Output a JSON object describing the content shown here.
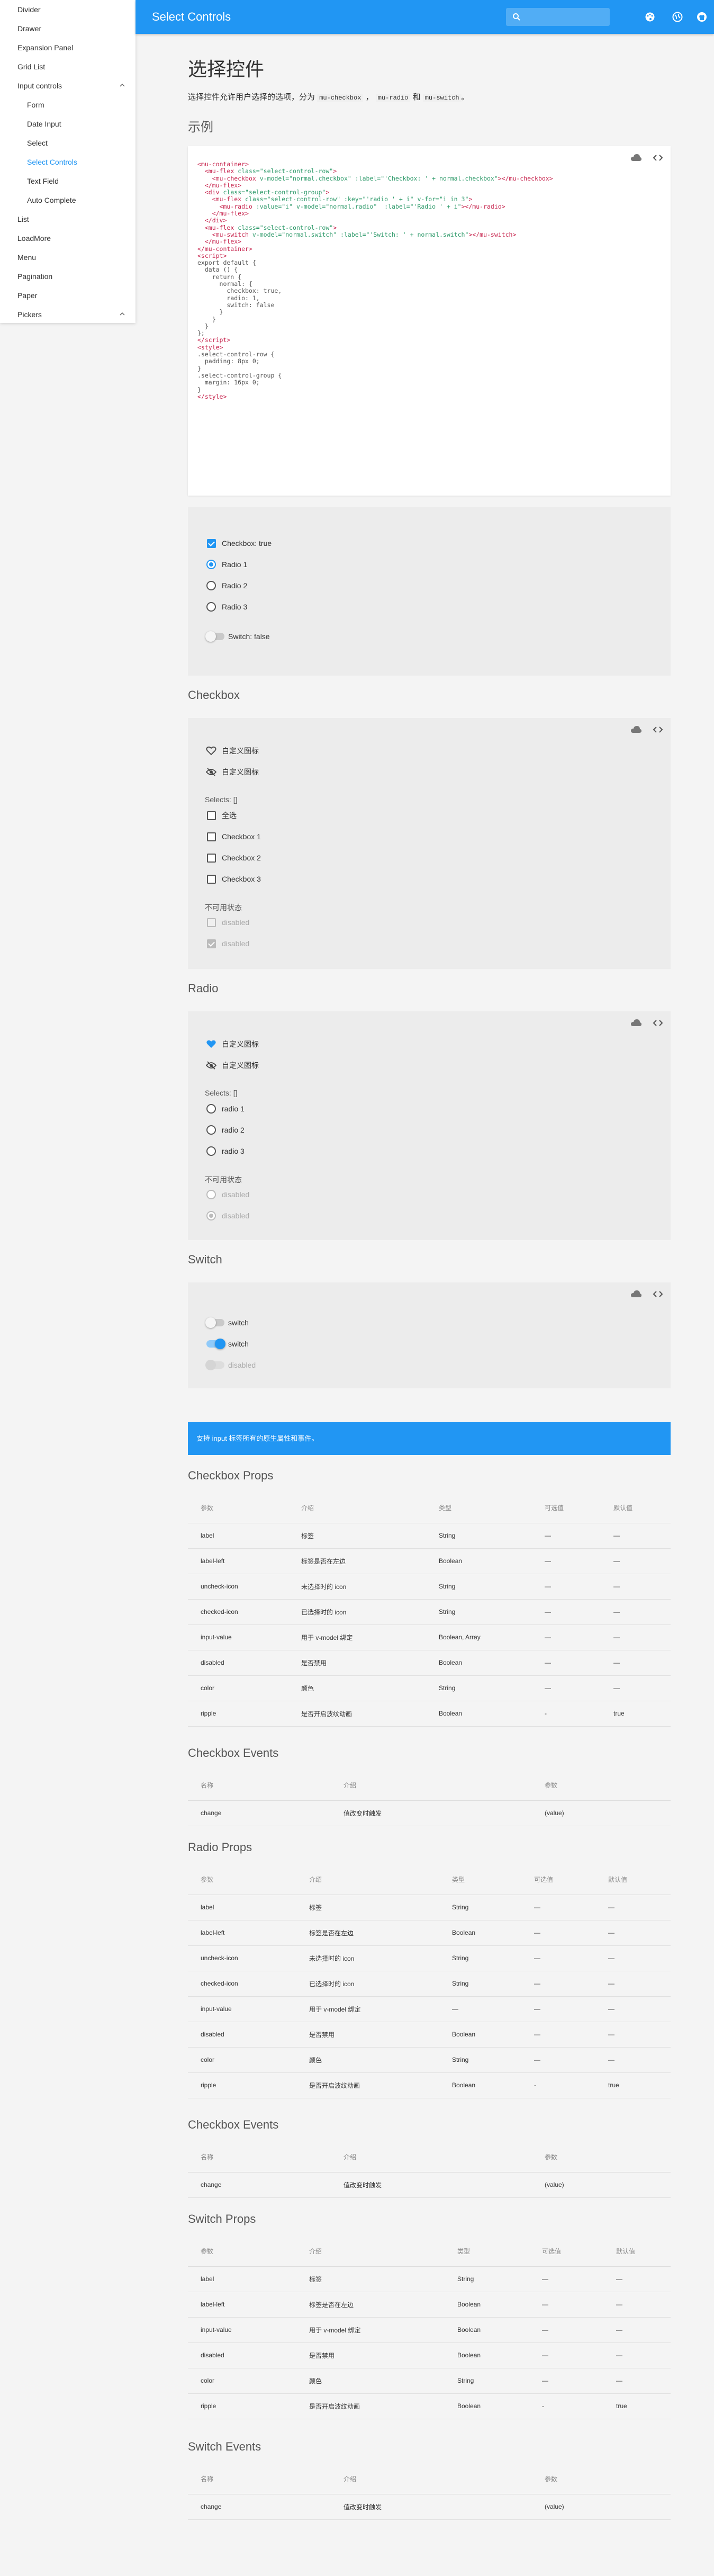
{
  "sidebar": {
    "items": [
      {
        "label": "Divider"
      },
      {
        "label": "Drawer"
      },
      {
        "label": "Expansion Panel"
      },
      {
        "label": "Grid List"
      },
      {
        "label": "Input controls"
      },
      {
        "label": "Form"
      },
      {
        "label": "Date Input"
      },
      {
        "label": "Select"
      },
      {
        "label": "Select Controls"
      },
      {
        "label": "Text Field"
      },
      {
        "label": "Auto Complete"
      },
      {
        "label": "List"
      },
      {
        "label": "LoadMore"
      },
      {
        "label": "Menu"
      },
      {
        "label": "Pagination"
      },
      {
        "label": "Paper"
      },
      {
        "label": "Pickers"
      }
    ]
  },
  "appbar": {
    "title": "Select Controls",
    "search_placeholder": ""
  },
  "page": {
    "title": "选择控件",
    "intro_prefix": "选择控件允许用户选择的选项，分为",
    "intro_code1": "mu-checkbox",
    "intro_sep1": "，",
    "intro_code2": "mu-radio",
    "intro_and": "和",
    "intro_code3": "mu-switch",
    "intro_end": "。",
    "example_heading": "示例"
  },
  "demo1": {
    "checkbox_label": "Checkbox: true",
    "radios": [
      "Radio 1",
      "Radio 2",
      "Radio 3"
    ],
    "switch_label": "Switch: false"
  },
  "checkbox_section": {
    "heading": "Checkbox",
    "custom1": "自定义图标",
    "custom2": "自定义图标",
    "selects": "Selects: []",
    "all": "全选",
    "items": [
      "Checkbox 1",
      "Checkbox 2",
      "Checkbox 3"
    ],
    "disabled_heading": "不可用状态",
    "disabled1": "disabled",
    "disabled2": "disabled"
  },
  "radio_section": {
    "heading": "Radio",
    "custom1": "自定义图标",
    "custom2": "自定义图标",
    "selects": "Selects: []",
    "items": [
      "radio 1",
      "radio 2",
      "radio 3"
    ],
    "disabled_heading": "不可用状态",
    "disabled1": "disabled",
    "disabled2": "disabled"
  },
  "switch_section": {
    "heading": "Switch",
    "items": [
      "switch",
      "switch",
      "disabled"
    ]
  },
  "info": "支持 input 标签所有的原生属性和事件。",
  "table_headers5": [
    "参数",
    "介绍",
    "类型",
    "可选值",
    "默认值"
  ],
  "table_headers3": [
    "名称",
    "介绍",
    "参数"
  ],
  "checkbox_props": {
    "heading": "Checkbox Props",
    "rows": [
      [
        "label",
        "标签",
        "String",
        "—",
        "—"
      ],
      [
        "label-left",
        "标签是否在左边",
        "Boolean",
        "—",
        "—"
      ],
      [
        "uncheck-icon",
        "未选择时的 icon",
        "String",
        "—",
        "—"
      ],
      [
        "checked-icon",
        "已选择时的 icon",
        "String",
        "—",
        "—"
      ],
      [
        "input-value",
        "用于 v-model 绑定",
        "Boolean, Array",
        "—",
        "—"
      ],
      [
        "disabled",
        "是否禁用",
        "Boolean",
        "—",
        "—"
      ],
      [
        "color",
        "颜色",
        "String",
        "—",
        "—"
      ],
      [
        "ripple",
        "是否开启波纹动画",
        "Boolean",
        "-",
        "true"
      ]
    ]
  },
  "checkbox_events": {
    "heading": "Checkbox Events",
    "rows": [
      [
        "change",
        "值改变时触发",
        "(value)"
      ]
    ]
  },
  "radio_props": {
    "heading": "Radio Props",
    "rows": [
      [
        "label",
        "标签",
        "String",
        "—",
        "—"
      ],
      [
        "label-left",
        "标签是否在左边",
        "Boolean",
        "—",
        "—"
      ],
      [
        "uncheck-icon",
        "未选择时的 icon",
        "String",
        "—",
        "—"
      ],
      [
        "checked-icon",
        "已选择时的 icon",
        "String",
        "—",
        "—"
      ],
      [
        "input-value",
        "用于 v-model 绑定",
        "—",
        "—",
        "—"
      ],
      [
        "disabled",
        "是否禁用",
        "Boolean",
        "—",
        "—"
      ],
      [
        "color",
        "颜色",
        "String",
        "—",
        "—"
      ],
      [
        "ripple",
        "是否开启波纹动画",
        "Boolean",
        "-",
        "true"
      ]
    ]
  },
  "radio_events": {
    "heading": "Checkbox Events",
    "rows": [
      [
        "change",
        "值改变时触发",
        "(value)"
      ]
    ]
  },
  "switch_props": {
    "heading": "Switch Props",
    "rows": [
      [
        "label",
        "标签",
        "String",
        "—",
        "—"
      ],
      [
        "label-left",
        "标签是否在左边",
        "Boolean",
        "—",
        "—"
      ],
      [
        "input-value",
        "用于 v-model 绑定",
        "Boolean",
        "—",
        "—"
      ],
      [
        "disabled",
        "是否禁用",
        "Boolean",
        "—",
        "—"
      ],
      [
        "color",
        "颜色",
        "String",
        "—",
        "—"
      ],
      [
        "ripple",
        "是否开启波纹动画",
        "Boolean",
        "-",
        "true"
      ]
    ]
  },
  "switch_events": {
    "heading": "Switch Events",
    "rows": [
      [
        "change",
        "值改变时触发",
        "(value)"
      ]
    ]
  },
  "colors": {
    "primary": "#2196f3"
  }
}
